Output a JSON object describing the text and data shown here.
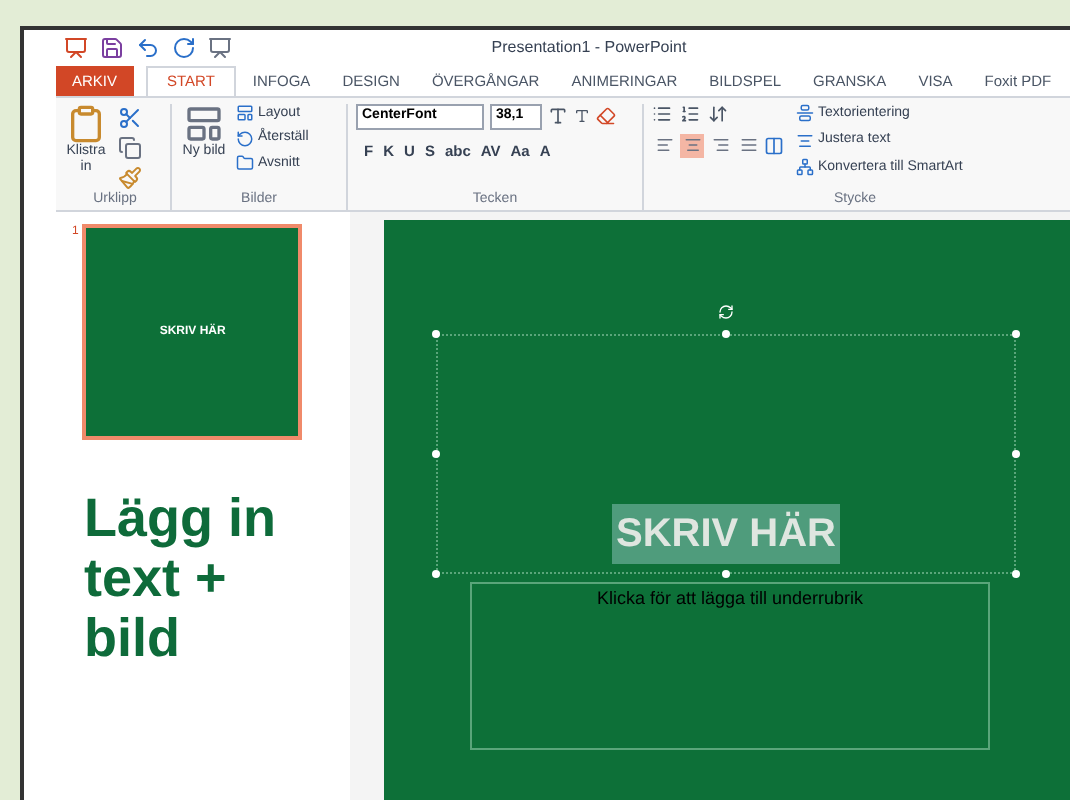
{
  "window": {
    "title": "Presentation1 - PowerPoint"
  },
  "tabs": [
    {
      "label": "ARKIV",
      "kind": "file",
      "selected": false
    },
    {
      "label": "START",
      "kind": "tab",
      "selected": true
    },
    {
      "label": "INFOGA",
      "kind": "tab",
      "selected": false
    },
    {
      "label": "DESIGN",
      "kind": "tab",
      "selected": false
    },
    {
      "label": "ÖVERGÅNGAR",
      "kind": "tab",
      "selected": false
    },
    {
      "label": "ANIMERINGAR",
      "kind": "tab",
      "selected": false
    },
    {
      "label": "BILDSPEL",
      "kind": "tab",
      "selected": false
    },
    {
      "label": "GRANSKA",
      "kind": "tab",
      "selected": false
    },
    {
      "label": "VISA",
      "kind": "tab",
      "selected": false
    },
    {
      "label": "Foxit PDF",
      "kind": "tab",
      "selected": false
    }
  ],
  "ribbon": {
    "clipboard": {
      "paste": "Klistra in",
      "label": "Urklipp"
    },
    "slides": {
      "new_slide": "Ny bild",
      "items": [
        "Layout",
        "Återställ",
        "Avsnitt"
      ],
      "label": "Bilder"
    },
    "font": {
      "name": "CenterFont",
      "size": "38,1",
      "format_buttons": [
        "F",
        "K",
        "U",
        "S",
        "abc",
        "AV",
        "Aa",
        "A"
      ],
      "label": "Tecken"
    },
    "paragraph": {
      "alignment": [
        {
          "selected": false
        },
        {
          "selected": true
        },
        {
          "selected": false
        },
        {
          "selected": false
        }
      ],
      "commands": [
        "Textorientering",
        "Justera text",
        "Konvertera till SmartArt"
      ],
      "label": "Stycke"
    }
  },
  "slide_panel": {
    "number": "1",
    "thumbnail_title": "SKRIV HÄR",
    "selected": true
  },
  "callout": "Lägg in text + bild",
  "slide": {
    "title": "SKRIV HÄR",
    "subtitle_placeholder": "Klicka för att lägga till underrubrik"
  }
}
